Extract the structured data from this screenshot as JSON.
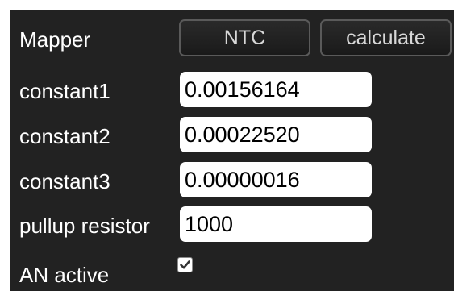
{
  "mapper": {
    "label": "Mapper",
    "type_button": "NTC",
    "calculate_button": "calculate"
  },
  "fields": {
    "constant1": {
      "label": "constant1",
      "value": "0.00156164"
    },
    "constant2": {
      "label": "constant2",
      "value": "0.00022520"
    },
    "constant3": {
      "label": "constant3",
      "value": "0.00000016"
    },
    "pullup": {
      "label": "pullup resistor",
      "value": "1000"
    }
  },
  "an_active": {
    "label": "AN active",
    "checked": true,
    "icon": "checkmark-icon"
  },
  "colors": {
    "panel_background": "#222222",
    "label_text": "#ffffff",
    "button_text": "#d8d8d8",
    "button_border": "#5a5a5a",
    "input_background": "#ffffff"
  }
}
